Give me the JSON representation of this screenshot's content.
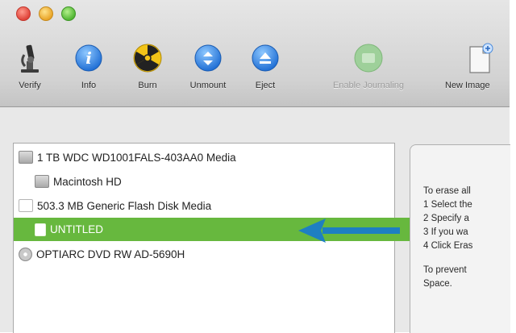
{
  "toolbar": {
    "items": [
      {
        "label": "Verify",
        "icon": "microscope-icon",
        "enabled": true
      },
      {
        "label": "Info",
        "icon": "info-icon",
        "enabled": true
      },
      {
        "label": "Burn",
        "icon": "burn-icon",
        "enabled": true
      },
      {
        "label": "Unmount",
        "icon": "unmount-icon",
        "enabled": true
      },
      {
        "label": "Eject",
        "icon": "eject-icon",
        "enabled": true
      },
      {
        "label": "Enable Journaling",
        "icon": "journaling-icon",
        "enabled": false
      },
      {
        "label": "New Image",
        "icon": "new-image-icon",
        "enabled": true
      }
    ]
  },
  "sidebar": {
    "items": [
      {
        "label": "1 TB WDC WD1001FALS-403AA0 Media",
        "icon": "hard-disk-icon",
        "selected": false
      },
      {
        "label": "Macintosh HD",
        "icon": "hard-disk-icon",
        "selected": false
      },
      {
        "label": "503.3 MB Generic Flash Disk Media",
        "icon": "usb-drive-icon",
        "selected": false
      },
      {
        "label": "UNTITLED",
        "icon": "volume-icon",
        "selected": true
      },
      {
        "label": "OPTIARC DVD RW AD-5690H",
        "icon": "dvd-drive-icon",
        "selected": false
      }
    ]
  },
  "info": {
    "lines": [
      "To erase all",
      "1 Select the",
      "2 Specify a",
      "3 If you wa",
      "4 Click Eras",
      "To prevent",
      "Space."
    ]
  },
  "colors": {
    "selection": "#67b83e",
    "arrow": "#1e7fc2"
  }
}
